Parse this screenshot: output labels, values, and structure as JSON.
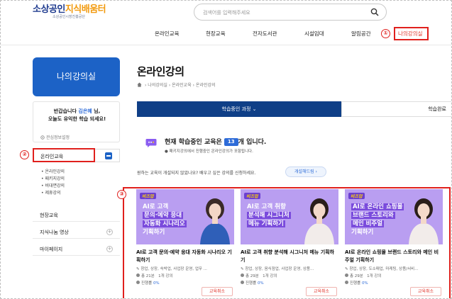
{
  "header": {
    "logo_main_a": "소상공인",
    "logo_main_b": "지식배움터",
    "logo_sub": "소상공인시장진흥공단",
    "search_placeholder": "검색어를 입력해주세요"
  },
  "nav": {
    "items": [
      "온라인교육",
      "현장교육",
      "전자도서관",
      "시설임대",
      "알림공간",
      "나의강의실"
    ],
    "active": "나의강의실"
  },
  "markers": [
    "①",
    "②",
    "③"
  ],
  "sidebar": {
    "title": "나의강의실",
    "welcome_pre": "반갑습니다 ",
    "user_name": "김은혜",
    "welcome_post": " 님,",
    "welcome_line2": "오늘도 유익한 학습 되세요!",
    "interest": "관심정보설정",
    "menu": [
      {
        "label": "온라인교육"
      },
      {
        "label": "현장교육"
      },
      {
        "label": "지식나눔 영상"
      },
      {
        "label": "마이페이지"
      }
    ],
    "submenu": [
      "온라인강의",
      "패키지강의",
      "비대면강의",
      "제휴강의"
    ]
  },
  "main": {
    "title": "온라인강의",
    "breadcrumb": "›  나의강의실  ›  온라인교육  ›  온라인강의",
    "tabs": [
      "학습중인 과정 ⌄",
      "학습완료"
    ],
    "notice_pre": "현재 학습중인 교육은 ",
    "notice_count": "13",
    "notice_post": "개 입니다.",
    "notice_sub": "● 패키지강의에서 진행중인 온라인강의가 포함됩니다.",
    "request_text": "원하는 교육이 개설되지 않았나요? 배우고 싶은 강의를 신청하세요.",
    "request_button": "개설해드림 ›"
  },
  "cards": [
    {
      "tag": "비즈업",
      "thumb_lines": [
        "AI로 고객",
        "문의·예약 응대",
        "자동화 시나리오",
        "기획하기"
      ],
      "title": "AI로 고객 문의·예약 응대 자동화 시나리오 기획하기",
      "tags": "창업, 상장, 숙박업, 사업장 운영, 업무 ...",
      "total": "총 21분",
      "lectures": "1개 강의",
      "progress_label": "진행률 ",
      "progress": "0%",
      "button": "교육취소"
    },
    {
      "tag": "비즈업",
      "thumb_lines": [
        "AI로 고객 취향",
        "분석해 시그니처",
        "메뉴 기획하기"
      ],
      "title": "AI로 고객 취향 분석해 시그니처 메뉴 기획하기",
      "tags": "창업, 상장, 음식점업, 사업장 운영, 상품...",
      "total": "총 29분",
      "lectures": "1개 강의",
      "progress_label": "진행률 ",
      "progress": "0%",
      "button": "교육취소"
    },
    {
      "tag": "비즈업",
      "thumb_lines": [
        "AI로 온라인 쇼핑몰",
        "브랜드 스토리와",
        "메인 비주얼",
        "기획하기"
      ],
      "title": "AI로 온라인 쇼핑몰 브랜드 스토리와 메인 비주얼 기획하기",
      "tags": "창업, 상장, 도소매업, 마케팅, 상품/서비...",
      "total": "총 29분",
      "lectures": "1개 강의",
      "progress_label": "진행률 ",
      "progress": "0%",
      "button": "교육취소"
    }
  ],
  "colors": {
    "brand_blue": "#1c62c6",
    "tab_navy": "#0f3f87",
    "alert_red": "#e0201d",
    "thumb_purple": "#b99ef1"
  }
}
